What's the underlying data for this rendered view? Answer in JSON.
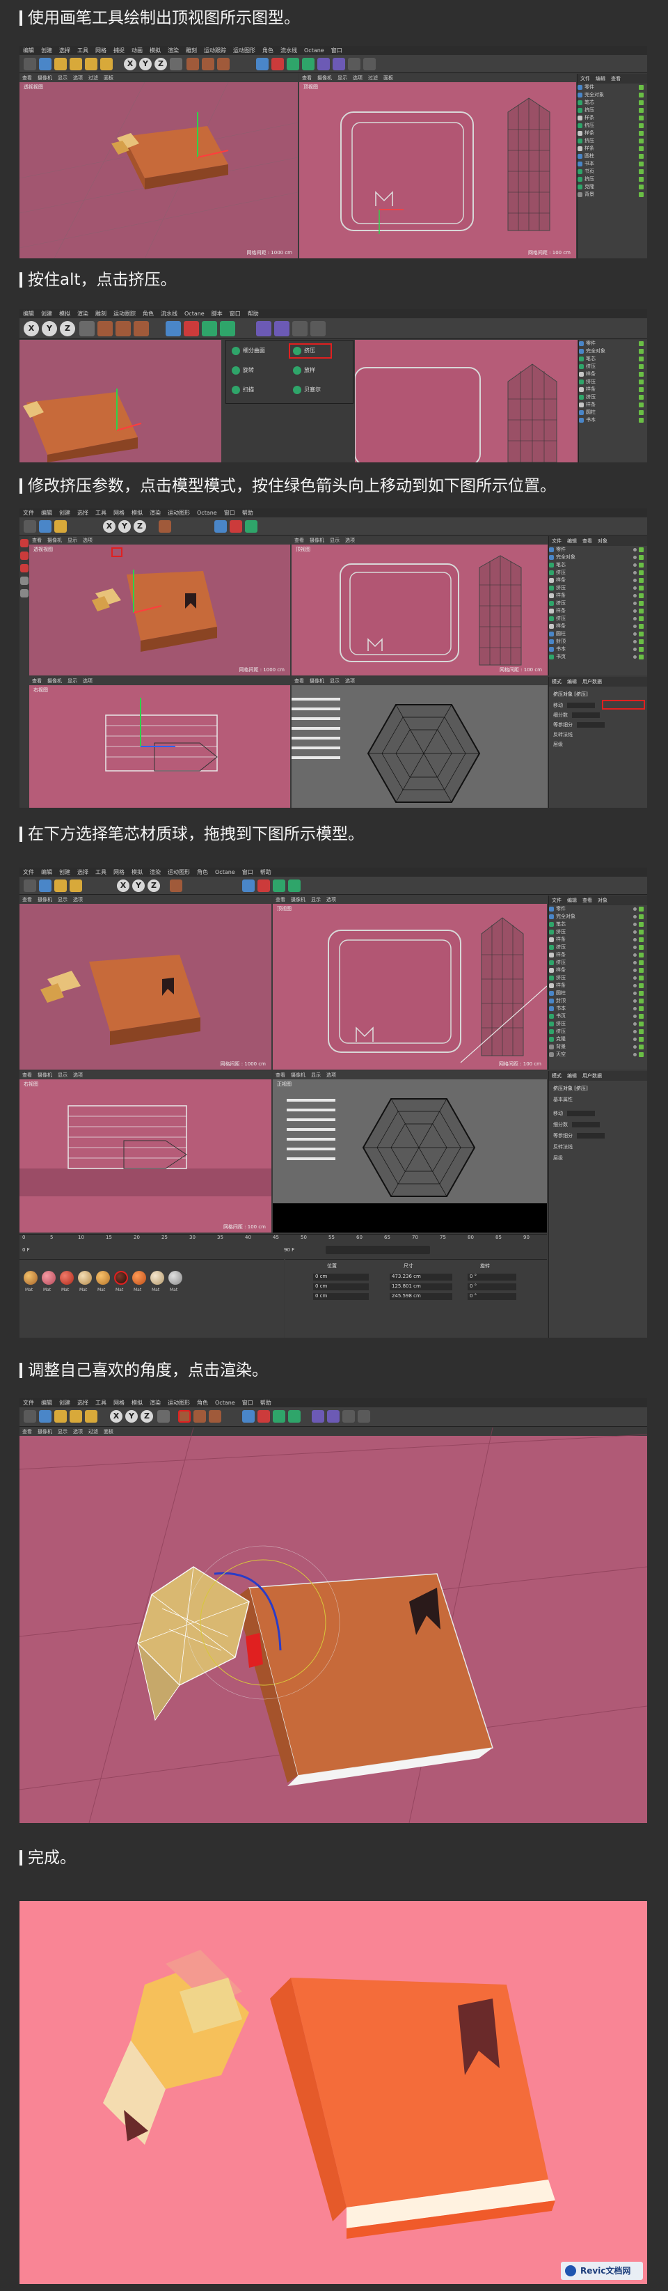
{
  "steps": [
    {
      "title": "使用画笔工具绘制出顶视图所示图型。"
    },
    {
      "title": "按住alt，点击挤压。"
    },
    {
      "title": "修改挤压参数，点击模型模式，按住绿色箭头向上移动到如下图所示位置。"
    },
    {
      "title": "在下方选择笔芯材质球，拖拽到下图所示模型。"
    },
    {
      "title": "调整自己喜欢的角度，点击渲染。"
    },
    {
      "title": "完成。"
    }
  ],
  "c4d": {
    "menu": [
      "文件",
      "编辑",
      "创建",
      "选择",
      "工具",
      "网格",
      "捕捉",
      "动画",
      "模拟",
      "渲染",
      "雕刻",
      "运动跟踪",
      "运动图形",
      "角色",
      "流水线",
      "插件",
      "Octane",
      "脚本",
      "窗口",
      "帮助"
    ],
    "menu_short": [
      "编辑",
      "创建",
      "模拟",
      "渲染",
      "雕刻",
      "运动跟踪",
      "角色",
      "流水线",
      "Octane",
      "脚本",
      "窗口",
      "帮助"
    ],
    "vp_menu": [
      "查看",
      "摄像机",
      "显示",
      "选项",
      "过滤",
      "面板"
    ],
    "vp_perspective": "透视视图",
    "vp_top": "顶视图",
    "vp_right": "右视图",
    "vp_front": "正视图",
    "scale_top": "网格间距 : 1000 cm",
    "scale_side": "网格间距 : 100 cm",
    "xyz": [
      "X",
      "Y",
      "Z"
    ],
    "panel_tabs": [
      "文件",
      "编辑",
      "查看",
      "对象",
      "标签",
      "书签"
    ],
    "attr_tabs": [
      "模式",
      "编辑",
      "用户数据"
    ],
    "objects": [
      "零件",
      "完全对象",
      "笔芯",
      "挤压",
      "样条",
      "挤压",
      "样条",
      "挤压",
      "样条",
      "挤压",
      "样条",
      "圆柱",
      "封顶",
      "书本",
      "书页",
      "挤压",
      "挤压",
      "克隆",
      "背景",
      "天空"
    ]
  },
  "popup": {
    "items": [
      "细分曲面",
      "挤压",
      "旋转",
      "放样",
      "扫描",
      "贝塞尔"
    ]
  },
  "attr": {
    "title": "挤压对象 [挤压]",
    "rows": [
      "移动",
      "细分数",
      "等参细分",
      "反转法线",
      "层级"
    ],
    "render_label": "基本属性"
  },
  "timeline": {
    "ticks": [
      "0",
      "5",
      "10",
      "15",
      "20",
      "25",
      "30",
      "35",
      "40",
      "45",
      "50",
      "55",
      "60",
      "65",
      "70",
      "75",
      "80",
      "85",
      "90"
    ],
    "frame_start": "0 F",
    "frame_end": "90 F"
  },
  "materials": [
    "Mat",
    "Mat",
    "Mat",
    "Mat",
    "Mat",
    "Mat",
    "Mat",
    "Mat",
    "Mat"
  ],
  "coords": {
    "labels": [
      "位置",
      "尺寸",
      "旋转"
    ],
    "x": [
      "0 cm",
      "473.236 cm",
      "0 °"
    ],
    "y": [
      "0 cm",
      "125.801 cm",
      "0 °"
    ],
    "z": [
      "0 cm",
      "245.598 cm",
      "0 °"
    ]
  },
  "watermark": "Revic文档网",
  "colors": {
    "viewport_pink": "#b65c78",
    "book_orange": "#c76a3a",
    "render_bg": "#f98595"
  }
}
